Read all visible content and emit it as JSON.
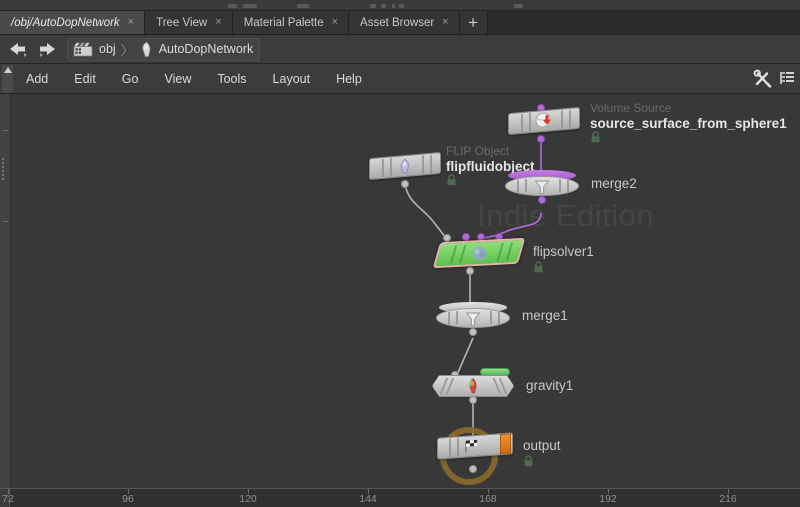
{
  "window": {
    "title": "/obj/AutoDopNetwork"
  },
  "tabs": [
    {
      "label": "/obj/AutoDopNetwork",
      "close": "×",
      "active": true
    },
    {
      "label": "Tree View",
      "close": "×",
      "active": false
    },
    {
      "label": "Material Palette",
      "close": "×",
      "active": false
    },
    {
      "label": "Asset Browser",
      "close": "×",
      "active": false
    }
  ],
  "tab_add_label": "+",
  "pathbar": {
    "back_icon": "back-arrow-icon",
    "forward_icon": "forward-arrow-icon",
    "crumbs": [
      {
        "label": "obj",
        "icon": "clapperboard-icon"
      },
      {
        "label": "AutoDopNetwork",
        "icon": "dynamics-icon"
      }
    ],
    "separator": "〉"
  },
  "menu": {
    "items": [
      "Add",
      "Edit",
      "Go",
      "View",
      "Tools",
      "Layout",
      "Help"
    ],
    "tools_icon": "wrench-screwdriver-icon",
    "list_icon": "tree-list-icon"
  },
  "canvas": {
    "watermark": "Indie Edition",
    "background_color": "#383838"
  },
  "nodes": [
    {
      "id": "source_surface_from_sphere1",
      "name": "source_surface_from_sphere1",
      "type_label": "Volume Source",
      "icon": "volume-source-icon",
      "locked": true,
      "shape": "slab",
      "selected": false
    },
    {
      "id": "flipfluidobject",
      "name": "flipfluidobject",
      "type_label": "FLIP Object",
      "icon": "flip-object-icon",
      "locked": true,
      "shape": "slab",
      "selected": false
    },
    {
      "id": "merge2",
      "name": "merge2",
      "type_label": "",
      "icon": "merge-funnel-icon",
      "locked": false,
      "shape": "disc",
      "selected": false
    },
    {
      "id": "flipsolver1",
      "name": "flipsolver1",
      "type_label": "",
      "icon": "flip-solver-icon",
      "locked": true,
      "shape": "solver",
      "selected": true
    },
    {
      "id": "merge1",
      "name": "merge1",
      "type_label": "",
      "icon": "merge-funnel-icon",
      "locked": false,
      "shape": "disc",
      "selected": false
    },
    {
      "id": "gravity1",
      "name": "gravity1",
      "type_label": "",
      "icon": "gravity-icon",
      "locked": false,
      "shape": "hex",
      "selected": false
    },
    {
      "id": "output",
      "name": "output",
      "type_label": "",
      "icon": "output-flag-icon",
      "locked": true,
      "shape": "slab",
      "selected": false
    }
  ],
  "colors": {
    "selected_border": "#e8b3a8",
    "selected_fill": "#6ecb5c",
    "data_wire": "#b06ed8",
    "object_wire": "#b4b4b4",
    "display_ring": "#8a6a2c",
    "bypass_tab": "#58b458",
    "render_tab": "#e07820"
  },
  "ruler": {
    "ticks": [
      72,
      96,
      120,
      144,
      168,
      192,
      216
    ]
  }
}
